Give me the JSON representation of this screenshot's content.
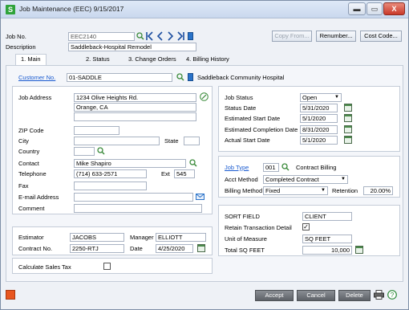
{
  "window": {
    "title": "Job Maintenance (EEC) 9/15/2017",
    "app_icon_letter": "S",
    "buttons": {
      "minimize": "▬",
      "maximize": "▭",
      "close": "X"
    }
  },
  "header": {
    "job_no_label": "Job No.",
    "job_no_value": "EEC2140",
    "description_label": "Description",
    "description_value": "Saddleback-Hospital Remodel",
    "copy_from_label": "Copy From...",
    "renumber_label": "Renumber...",
    "cost_code_label": "Cost Code..."
  },
  "tabs": [
    {
      "label": "1. Main",
      "active": true
    },
    {
      "label": "2. Status",
      "active": false
    },
    {
      "label": "3. Change Orders",
      "active": false
    },
    {
      "label": "4. Billing History",
      "active": false
    }
  ],
  "customer": {
    "label": "Customer No.",
    "value": "01-SADDLE",
    "name": "Saddleback Community Hospital"
  },
  "address": {
    "job_address_label": "Job Address",
    "line1": "1234 Olive Heights Rd.",
    "line2": "Orange, CA",
    "zip_label": "ZIP Code",
    "city_label": "City",
    "state_label": "State",
    "country_label": "Country",
    "contact_label": "Contact",
    "contact_value": "Mike Shapiro",
    "telephone_label": "Telephone",
    "telephone_value": "(714) 633-2571",
    "ext_label": "Ext",
    "ext_value": "545",
    "fax_label": "Fax",
    "email_label": "E-mail Address",
    "comment_label": "Comment"
  },
  "status": {
    "job_status_label": "Job Status",
    "job_status_value": "Open",
    "status_date_label": "Status Date",
    "status_date_value": "5/31/2020",
    "est_start_label": "Estimated Start Date",
    "est_start_value": "5/1/2020",
    "est_completion_label": "Estimated Completion Date",
    "est_completion_value": "8/31/2020",
    "actual_start_label": "Actual Start Date",
    "actual_start_value": "5/1/2020"
  },
  "billing": {
    "job_type_label": "Job Type",
    "job_type_value": "001",
    "job_type_desc": "Contract Billing",
    "acct_method_label": "Acct Method",
    "acct_method_value": "Completed Contract",
    "billing_method_label": "Billing Method",
    "billing_method_value": "Fixed",
    "retention_label": "Retention",
    "retention_value": "20.00%"
  },
  "estimator": {
    "estimator_label": "Estimator",
    "estimator_value": "JACOBS",
    "manager_label": "Manager",
    "manager_value": "ELLIOTT",
    "contract_no_label": "Contract No.",
    "contract_no_value": "2250-RTJ",
    "date_label": "Date",
    "date_value": "4/25/2020"
  },
  "tax": {
    "label": "Calculate Sales Tax",
    "checked": false
  },
  "extra": {
    "sort_field_label": "SORT FIELD",
    "sort_field_value": "CLIENT",
    "retain_label": "Retain Transaction Detail",
    "retain_checked": true,
    "retain_mark": "✓",
    "uom_label": "Unit of Measure",
    "uom_value": "SQ FEET",
    "total_sq_label": "Total SQ FEET",
    "total_sq_value": "10,000"
  },
  "footer": {
    "accept_label": "Accept",
    "cancel_label": "Cancel",
    "delete_label": "Delete",
    "printer_icon": "printer-icon",
    "help_icon": "help-icon"
  },
  "colors": {
    "title_bar": "#c9d8ee",
    "link": "#1a5bd0",
    "app_icon": "#2fa33a",
    "close_button": "#c9392a"
  }
}
